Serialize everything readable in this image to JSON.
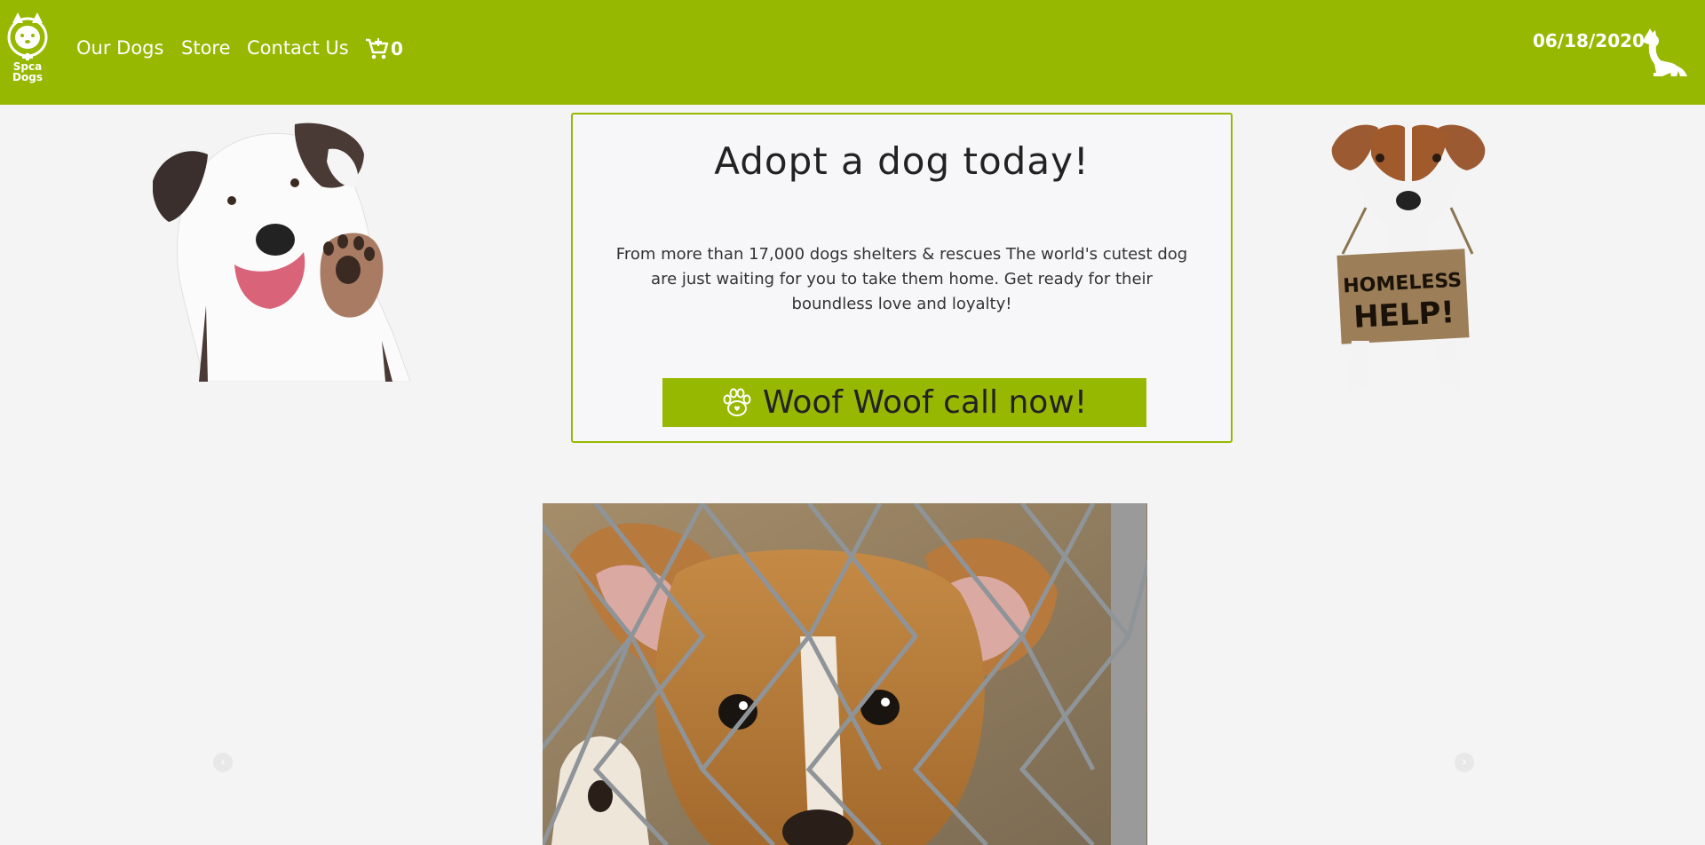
{
  "navbar": {
    "logo_text_line1": "Spca",
    "logo_text_line2": "Dogs",
    "links": [
      "Our Dogs",
      "Store",
      "Contact Us"
    ],
    "cart_count": "0",
    "date": "06/18/2020"
  },
  "hero": {
    "title": "Adopt a dog today!",
    "description": "From more than 17,000 dogs shelters & rescues The world's cutest dog are just waiting for you to take them home. Get ready for their boundless love and loyalty!",
    "cta_label": "Woof Woof call now!"
  },
  "sign": {
    "line1": "HOMELESS",
    "line2": "HELP!"
  },
  "colors": {
    "brand_green": "#96b800",
    "page_bg": "#f4f4f4"
  },
  "icons": [
    "dog-logo-icon",
    "cart-icon",
    "dog-silhouette-icon",
    "paw-icon",
    "chevron-left-icon",
    "chevron-right-icon"
  ]
}
